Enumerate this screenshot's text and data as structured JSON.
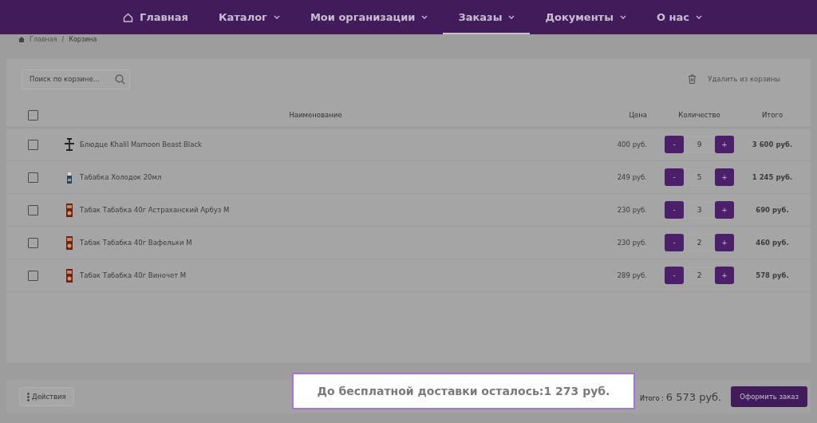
{
  "nav": [
    {
      "label": "Главная",
      "dropdown": false,
      "selected": false
    },
    {
      "label": "Каталог",
      "dropdown": true,
      "selected": false
    },
    {
      "label": "Мои организации",
      "dropdown": true,
      "selected": false
    },
    {
      "label": "Заказы",
      "dropdown": true,
      "selected": true
    },
    {
      "label": "Документы",
      "dropdown": true,
      "selected": false
    },
    {
      "label": "О нас",
      "dropdown": true,
      "selected": false
    }
  ],
  "breadcrumb": [
    "Главная",
    "Корзина"
  ],
  "breadcrumb_separator": "/",
  "search": {
    "placeholder": "Поиск по корзине..."
  },
  "delete_button": {
    "label": "Удалить из корзины",
    "disabled": true
  },
  "table": {
    "select_all_checked": false,
    "columns": [
      "Наименование",
      "Цена",
      "Количество",
      "Итого"
    ],
    "rows": [
      {
        "name": "Блюдце Khalil Mamoon Beast Black",
        "price": "400 руб.",
        "quantity": "9",
        "total": "3 600 руб.",
        "checked": false
      },
      {
        "name": "Табабка Холодок 20мл",
        "price": "249 руб.",
        "quantity": "5",
        "total": "1 245 руб.",
        "checked": false
      },
      {
        "name": "Табак Табабка 40г Астраханский Арбуз М",
        "price": "230 руб.",
        "quantity": "3",
        "total": "690 руб.",
        "checked": false
      },
      {
        "name": "Табак Табабка 40г Вафельки М",
        "price": "230 руб.",
        "quantity": "2",
        "total": "460 руб.",
        "checked": false
      },
      {
        "name": "Табак Табабка 40г Виночет М",
        "price": "289 руб.",
        "quantity": "2",
        "total": "578 руб.",
        "checked": false
      }
    ],
    "minus": "-",
    "plus": "+"
  },
  "footer": {
    "actions_label": "Действия",
    "total_label": "Итого :",
    "total_value": "6 573 руб.",
    "checkout_label": "Оформить заказ"
  },
  "popup": {
    "text": "До бесплатной доставки осталось:1 273 руб."
  }
}
